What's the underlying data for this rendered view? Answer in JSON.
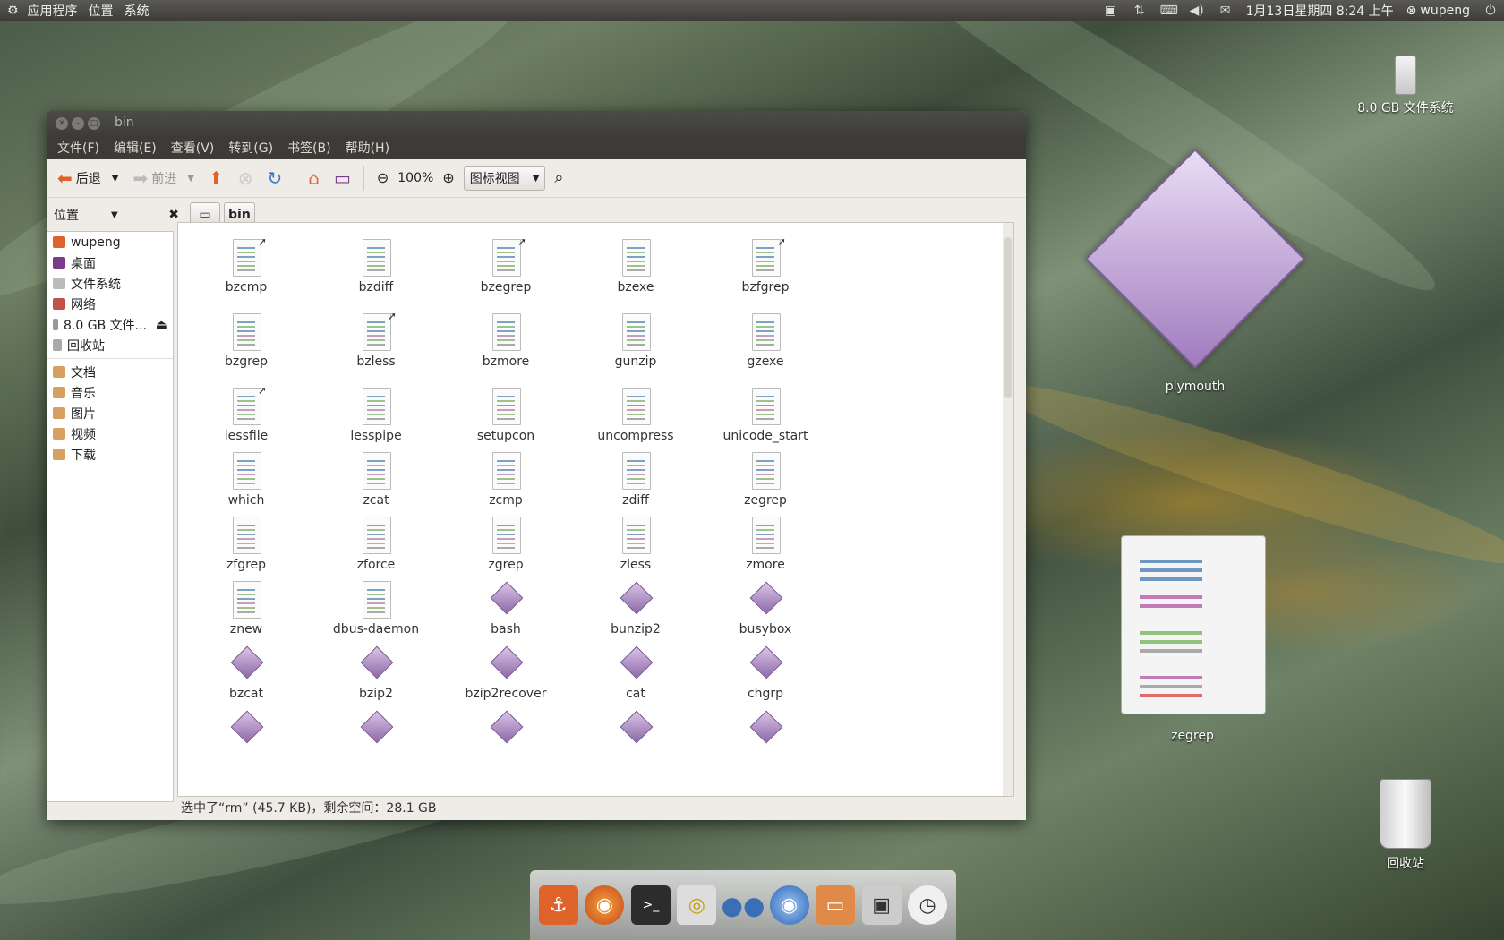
{
  "top_panel": {
    "menus": [
      "应用程序",
      "位置",
      "系统"
    ],
    "datetime": "1月13日星期四 8:24 上午",
    "user": "wupeng",
    "tray_icons": [
      "camera-icon",
      "network-icon",
      "keyboard-icon",
      "volume-icon",
      "mail-icon"
    ]
  },
  "desktop": {
    "usb_label": "8.0 GB 文件系统",
    "plymouth_label": "plymouth",
    "zegrep_label": "zegrep",
    "trash_label": "回收站"
  },
  "window": {
    "title": "bin",
    "menu": [
      "文件(F)",
      "编辑(E)",
      "查看(V)",
      "转到(G)",
      "书签(B)",
      "帮助(H)"
    ],
    "toolbar": {
      "back": "后退",
      "forward": "前进",
      "zoom": "100%",
      "view_mode": "图标视图"
    },
    "sidebar_header": "位置",
    "breadcrumb_current": "bin",
    "sidebar_places": [
      "wupeng",
      "桌面",
      "文件系统",
      "网络",
      "8.0 GB 文件...",
      "回收站"
    ],
    "sidebar_bookmarks": [
      "文档",
      "音乐",
      "图片",
      "视频",
      "下载"
    ],
    "status": "选中了“rm” (45.7 KB)，剩余空间：28.1 GB"
  },
  "files": [
    {
      "name": "bzcmp",
      "type": "script",
      "link": true
    },
    {
      "name": "bzdiff",
      "type": "script",
      "link": false
    },
    {
      "name": "bzegrep",
      "type": "script",
      "link": true
    },
    {
      "name": "bzexe",
      "type": "script",
      "link": false
    },
    {
      "name": "bzfgrep",
      "type": "script",
      "link": true
    },
    {
      "name": "bzgrep",
      "type": "script",
      "link": false
    },
    {
      "name": "bzless",
      "type": "script",
      "link": true
    },
    {
      "name": "bzmore",
      "type": "script",
      "link": false
    },
    {
      "name": "gunzip",
      "type": "script",
      "link": false
    },
    {
      "name": "gzexe",
      "type": "script",
      "link": false
    },
    {
      "name": "lessfile",
      "type": "script",
      "link": true
    },
    {
      "name": "lesspipe",
      "type": "script",
      "link": false
    },
    {
      "name": "setupcon",
      "type": "script",
      "link": false
    },
    {
      "name": "uncompress",
      "type": "script",
      "link": false
    },
    {
      "name": "unicode_start",
      "type": "script",
      "link": false
    },
    {
      "name": "which",
      "type": "script",
      "link": false
    },
    {
      "name": "zcat",
      "type": "script",
      "link": false
    },
    {
      "name": "zcmp",
      "type": "script",
      "link": false
    },
    {
      "name": "zdiff",
      "type": "script",
      "link": false
    },
    {
      "name": "zegrep",
      "type": "script",
      "link": false
    },
    {
      "name": "zfgrep",
      "type": "script",
      "link": false
    },
    {
      "name": "zforce",
      "type": "script",
      "link": false
    },
    {
      "name": "zgrep",
      "type": "script",
      "link": false
    },
    {
      "name": "zless",
      "type": "script",
      "link": false
    },
    {
      "name": "zmore",
      "type": "script",
      "link": false
    },
    {
      "name": "znew",
      "type": "script",
      "link": false
    },
    {
      "name": "dbus-daemon",
      "type": "script",
      "link": false
    },
    {
      "name": "bash",
      "type": "binary",
      "link": false
    },
    {
      "name": "bunzip2",
      "type": "binary",
      "link": false
    },
    {
      "name": "busybox",
      "type": "binary",
      "link": false
    },
    {
      "name": "bzcat",
      "type": "binary",
      "link": false
    },
    {
      "name": "bzip2",
      "type": "binary",
      "link": false
    },
    {
      "name": "bzip2recover",
      "type": "binary",
      "link": false
    },
    {
      "name": "cat",
      "type": "binary",
      "link": false
    },
    {
      "name": "chgrp",
      "type": "binary",
      "link": false
    },
    {
      "name": "",
      "type": "binary",
      "link": false
    },
    {
      "name": "",
      "type": "binary",
      "link": false
    },
    {
      "name": "",
      "type": "binary",
      "link": false
    },
    {
      "name": "",
      "type": "binary",
      "link": false
    },
    {
      "name": "",
      "type": "binary",
      "link": false
    }
  ],
  "dock": [
    "anchor-icon",
    "firefox-icon",
    "terminal-icon",
    "speaker-icon",
    "pidgin-icon",
    "chromium-icon",
    "folder-icon",
    "camera-icon",
    "clock-icon"
  ]
}
